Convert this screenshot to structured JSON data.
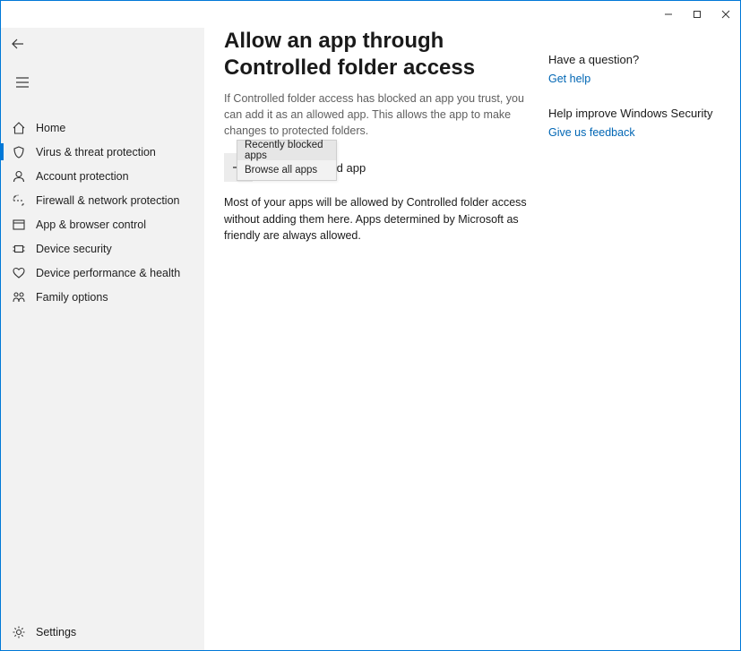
{
  "titlebar": {
    "minimize_name": "minimize",
    "maximize_name": "maximize",
    "close_name": "close"
  },
  "sidebar": {
    "back_label": "Back",
    "menu_label": "Menu",
    "items": [
      {
        "label": "Home"
      },
      {
        "label": "Virus & threat protection"
      },
      {
        "label": "Account protection"
      },
      {
        "label": "Firewall & network protection"
      },
      {
        "label": "App & browser control"
      },
      {
        "label": "Device security"
      },
      {
        "label": "Device performance & health"
      },
      {
        "label": "Family options"
      }
    ],
    "settings_label": "Settings"
  },
  "main": {
    "title": "Allow an app through Controlled folder access",
    "description": "If Controlled folder access has blocked an app you trust, you can add it as an allowed app. This allows the app to make changes to protected folders.",
    "add_button_label": "Add an allowed app",
    "info_text": "Most of your apps will be allowed by Controlled folder access without adding them here. Apps determined by Microsoft as friendly are always allowed."
  },
  "flyout": {
    "items": [
      {
        "label": "Recently blocked apps"
      },
      {
        "label": "Browse all apps"
      }
    ]
  },
  "right": {
    "question_heading": "Have a question?",
    "help_link": "Get help",
    "improve_heading": "Help improve Windows Security",
    "feedback_link": "Give us feedback"
  }
}
